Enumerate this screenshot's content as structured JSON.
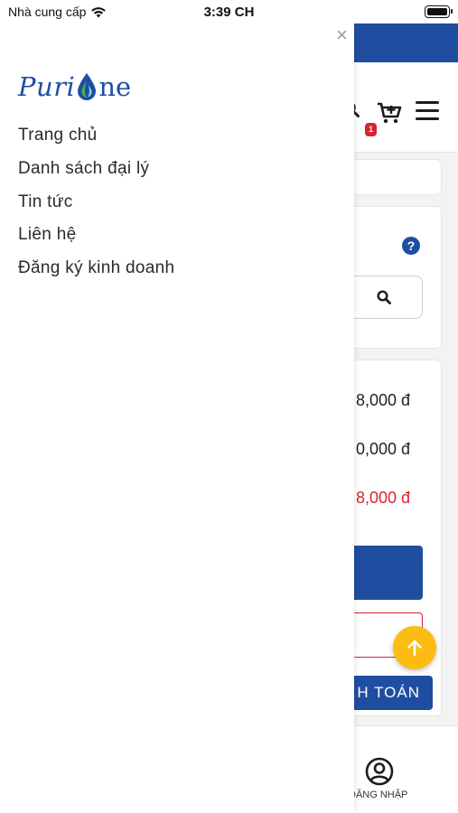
{
  "status_bar": {
    "carrier": "Nhà cung cấp",
    "time": "3:39 CH"
  },
  "drawer": {
    "close_symbol": "×",
    "logo_text_left": "Puri",
    "logo_text_right": "ne",
    "nav_items": [
      "Trang chủ",
      "Danh sách đại lý",
      "Tin tức",
      "Liên hệ",
      "Đăng ký kinh doanh"
    ]
  },
  "background": {
    "cart_badge": "1",
    "help_symbol": "?",
    "prices": [
      "8,000 đ",
      "0,000 đ",
      "8,000 đ"
    ],
    "pay_button_partial": "H TOÁN",
    "login_label_partial": "ĐĂNG NHẬP"
  },
  "colors": {
    "brand_blue": "#1f4ea1",
    "accent_red": "#d9232e",
    "scroll_button": "#fbbd12"
  },
  "icons": {
    "wifi": "wifi-icon",
    "battery": "battery-icon",
    "close": "close-icon",
    "search": "search-icon",
    "cart": "cart-icon",
    "menu": "hamburger-menu-icon",
    "help": "help-icon",
    "arrow_up": "arrow-up-icon",
    "user": "user-circle-icon"
  }
}
